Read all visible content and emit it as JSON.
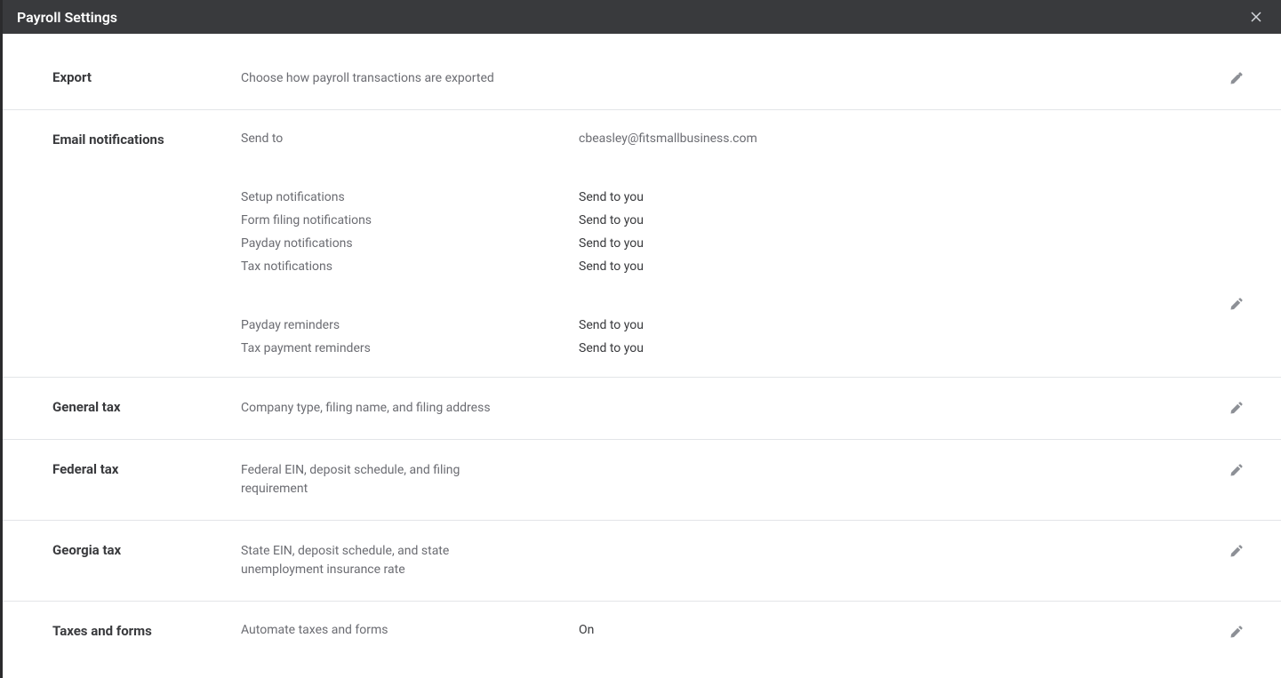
{
  "header": {
    "title": "Payroll Settings"
  },
  "sections": {
    "export": {
      "label": "Export",
      "desc": "Choose how payroll transactions are exported"
    },
    "email": {
      "label": "Email notifications",
      "send_to_key": "Send to",
      "send_to_val": "cbeasley@fitsmallbusiness.com",
      "rows": [
        {
          "key": "Setup notifications",
          "val": "Send to you"
        },
        {
          "key": "Form filing notifications",
          "val": "Send to you"
        },
        {
          "key": "Payday notifications",
          "val": "Send to you"
        },
        {
          "key": "Tax notifications",
          "val": "Send to you"
        }
      ],
      "rows2": [
        {
          "key": "Payday reminders",
          "val": "Send to you"
        },
        {
          "key": "Tax payment reminders",
          "val": "Send to you"
        }
      ]
    },
    "general_tax": {
      "label": "General tax",
      "desc": "Company type, filing name, and filing address"
    },
    "federal_tax": {
      "label": "Federal tax",
      "desc": "Federal EIN, deposit schedule, and filing requirement"
    },
    "georgia_tax": {
      "label": "Georgia tax",
      "desc": "State EIN, deposit schedule, and state unemployment insurance rate"
    },
    "taxes_forms": {
      "label": "Taxes and forms",
      "key": "Automate taxes and forms",
      "val": "On"
    }
  }
}
